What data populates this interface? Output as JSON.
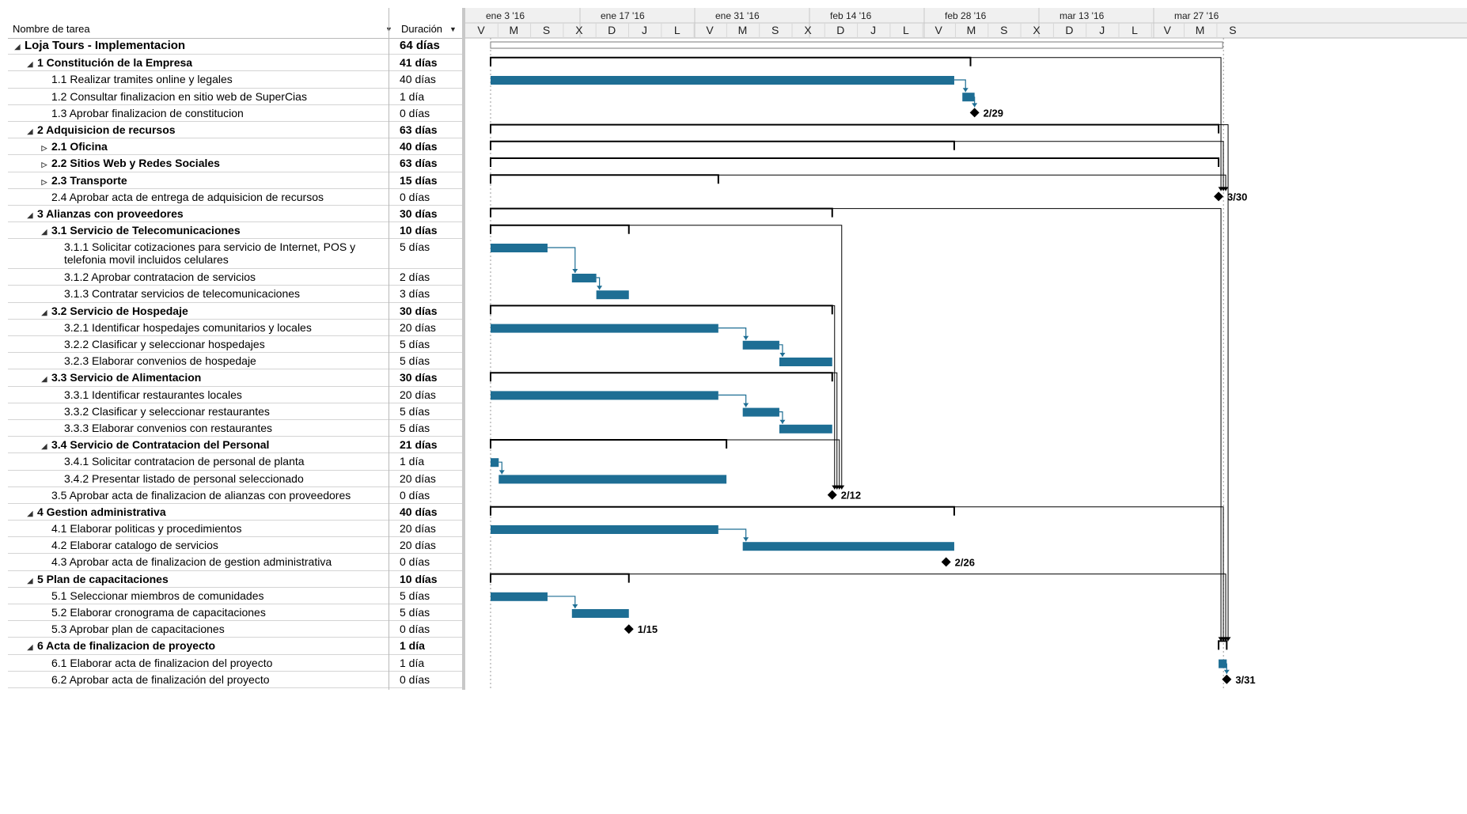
{
  "table": {
    "name_header": "Nombre de tarea",
    "duration_header": "Duración",
    "rows": [
      {
        "name": "Loja Tours - Implementacion",
        "duration": "64 días",
        "level": 0,
        "toggle": "◢",
        "bold": true,
        "big": true
      },
      {
        "name": "1 Constitución de la Empresa",
        "duration": "41 días",
        "level": 1,
        "toggle": "◢",
        "bold": true
      },
      {
        "name": "1.1 Realizar tramites online y legales",
        "duration": "40 días",
        "level": 2,
        "toggle": "",
        "bold": false
      },
      {
        "name": "1.2 Consultar finalizacion en sitio web de SuperCias",
        "duration": "1 día",
        "level": 2,
        "toggle": "",
        "bold": false
      },
      {
        "name": "1.3 Aprobar finalizacion de constitucion",
        "duration": "0 días",
        "level": 2,
        "toggle": "",
        "bold": false
      },
      {
        "name": "2 Adquisicion de recursos",
        "duration": "63 días",
        "level": 1,
        "toggle": "◢",
        "bold": true
      },
      {
        "name": "2.1 Oficina",
        "duration": "40 días",
        "level": 2,
        "toggle": "▷",
        "bold": true
      },
      {
        "name": "2.2 Sitios Web y Redes Sociales",
        "duration": "63 días",
        "level": 2,
        "toggle": "▷",
        "bold": true
      },
      {
        "name": "2.3 Transporte",
        "duration": "15 días",
        "level": 2,
        "toggle": "▷",
        "bold": true
      },
      {
        "name": "2.4 Aprobar acta de entrega de adquisicion de recursos",
        "duration": "0 días",
        "level": 2,
        "toggle": "",
        "bold": false
      },
      {
        "name": "3 Alianzas con proveedores",
        "duration": "30 días",
        "level": 1,
        "toggle": "◢",
        "bold": true
      },
      {
        "name": "3.1 Servicio de Telecomunicaciones",
        "duration": "10 días",
        "level": 2,
        "toggle": "◢",
        "bold": true
      },
      {
        "name": "3.1.1 Solicitar cotizaciones para servicio de Internet, POS y telefonia movil incluidos celulares",
        "duration": "5 días",
        "level": 3,
        "toggle": "",
        "bold": false,
        "tall": true
      },
      {
        "name": "3.1.2 Aprobar contratacion de servicios",
        "duration": "2 días",
        "level": 3,
        "toggle": "",
        "bold": false
      },
      {
        "name": "3.1.3 Contratar servicios de telecomunicaciones",
        "duration": "3 días",
        "level": 3,
        "toggle": "",
        "bold": false
      },
      {
        "name": "3.2 Servicio de Hospedaje",
        "duration": "30 días",
        "level": 2,
        "toggle": "◢",
        "bold": true
      },
      {
        "name": "3.2.1 Identificar hospedajes comunitarios y locales",
        "duration": "20 días",
        "level": 3,
        "toggle": "",
        "bold": false
      },
      {
        "name": "3.2.2 Clasificar y seleccionar hospedajes",
        "duration": "5 días",
        "level": 3,
        "toggle": "",
        "bold": false
      },
      {
        "name": "3.2.3 Elaborar convenios de hospedaje",
        "duration": "5 días",
        "level": 3,
        "toggle": "",
        "bold": false
      },
      {
        "name": "3.3 Servicio de Alimentacion",
        "duration": "30 días",
        "level": 2,
        "toggle": "◢",
        "bold": true
      },
      {
        "name": "3.3.1 Identificar restaurantes locales",
        "duration": "20 días",
        "level": 3,
        "toggle": "",
        "bold": false
      },
      {
        "name": "3.3.2 Clasificar y seleccionar restaurantes",
        "duration": "5 días",
        "level": 3,
        "toggle": "",
        "bold": false
      },
      {
        "name": "3.3.3 Elaborar convenios con restaurantes",
        "duration": "5 días",
        "level": 3,
        "toggle": "",
        "bold": false
      },
      {
        "name": "3.4 Servicio de Contratacion del Personal",
        "duration": "21 días",
        "level": 2,
        "toggle": "◢",
        "bold": true
      },
      {
        "name": "3.4.1 Solicitar contratacion de personal de planta",
        "duration": "1 día",
        "level": 3,
        "toggle": "",
        "bold": false
      },
      {
        "name": "3.4.2 Presentar listado de personal seleccionado",
        "duration": "20 días",
        "level": 3,
        "toggle": "",
        "bold": false
      },
      {
        "name": "3.5 Aprobar acta de finalizacion de alianzas con proveedores",
        "duration": "0 días",
        "level": 2,
        "toggle": "",
        "bold": false
      },
      {
        "name": "4 Gestion administrativa",
        "duration": "40 días",
        "level": 1,
        "toggle": "◢",
        "bold": true
      },
      {
        "name": "4.1 Elaborar politicas y procedimientos",
        "duration": "20 días",
        "level": 2,
        "toggle": "",
        "bold": false
      },
      {
        "name": "4.2 Elaborar catalogo de servicios",
        "duration": "20 días",
        "level": 2,
        "toggle": "",
        "bold": false
      },
      {
        "name": "4.3 Aprobar acta de finalizacion de gestion administrativa",
        "duration": "0 días",
        "level": 2,
        "toggle": "",
        "bold": false
      },
      {
        "name": "5 Plan de capacitaciones",
        "duration": "10 días",
        "level": 1,
        "toggle": "◢",
        "bold": true
      },
      {
        "name": "5.1 Seleccionar miembros de comunidades",
        "duration": "5 días",
        "level": 2,
        "toggle": "",
        "bold": false
      },
      {
        "name": "5.2 Elaborar cronograma de capacitaciones",
        "duration": "5 días",
        "level": 2,
        "toggle": "",
        "bold": false
      },
      {
        "name": "5.3 Aprobar plan de capacitaciones",
        "duration": "0 días",
        "level": 2,
        "toggle": "",
        "bold": false
      },
      {
        "name": "6 Acta de finalizacion de proyecto",
        "duration": "1 día",
        "level": 1,
        "toggle": "◢",
        "bold": true
      },
      {
        "name": "6.1 Elaborar acta de finalizacion del proyecto",
        "duration": "1 día",
        "level": 2,
        "toggle": "",
        "bold": false
      },
      {
        "name": "6.2 Aprobar acta de finalización del proyecto",
        "duration": "0 días",
        "level": 2,
        "toggle": "",
        "bold": false
      }
    ]
  },
  "chart_data": {
    "type": "gantt",
    "project_start": "2016-01-01",
    "timescale_top": [
      "ene 3 '16",
      "ene 17 '16",
      "ene 31 '16",
      "feb 14 '16",
      "feb 28 '16",
      "mar 13 '16",
      "mar 27 '16"
    ],
    "timescale_bottom": [
      "V",
      "M",
      "S",
      "X",
      "D",
      "J",
      "L",
      "V",
      "M",
      "S",
      "X",
      "D",
      "J",
      "L",
      "V",
      "M",
      "S",
      "X",
      "D",
      "J",
      "L",
      "V",
      "M",
      "S"
    ],
    "colors": {
      "task_bar": "#1e6e94",
      "summary_bar": "#000000",
      "link": "#1e6e94",
      "milestone": "#000000"
    },
    "tasks": [
      {
        "kind": "summary",
        "start": "2016-01-01",
        "end": "2016-03-31",
        "project": true
      },
      {
        "kind": "summary",
        "start": "2016-01-01",
        "end": "2016-02-29"
      },
      {
        "kind": "task",
        "start": "2016-01-01",
        "end": "2016-02-27"
      },
      {
        "kind": "task",
        "start": "2016-02-28",
        "end": "2016-02-29.5"
      },
      {
        "kind": "milestone",
        "start": "2016-02-29.5",
        "label": "2/29"
      },
      {
        "kind": "summary",
        "start": "2016-01-01",
        "end": "2016-03-30.5"
      },
      {
        "kind": "summary",
        "start": "2016-01-01",
        "end": "2016-02-27"
      },
      {
        "kind": "summary",
        "start": "2016-01-01",
        "end": "2016-03-30.5"
      },
      {
        "kind": "summary",
        "start": "2016-01-01",
        "end": "2016-01-29"
      },
      {
        "kind": "milestone",
        "start": "2016-03-30.5",
        "label": "3/30"
      },
      {
        "kind": "summary",
        "start": "2016-01-01",
        "end": "2016-02-12"
      },
      {
        "kind": "summary",
        "start": "2016-01-01",
        "end": "2016-01-18"
      },
      {
        "kind": "task",
        "start": "2016-01-01",
        "end": "2016-01-08"
      },
      {
        "kind": "task",
        "start": "2016-01-11",
        "end": "2016-01-14"
      },
      {
        "kind": "task",
        "start": "2016-01-14",
        "end": "2016-01-18"
      },
      {
        "kind": "summary",
        "start": "2016-01-01",
        "end": "2016-02-12"
      },
      {
        "kind": "task",
        "start": "2016-01-01",
        "end": "2016-01-29"
      },
      {
        "kind": "task",
        "start": "2016-02-01",
        "end": "2016-02-05.5"
      },
      {
        "kind": "task",
        "start": "2016-02-05.5",
        "end": "2016-02-12"
      },
      {
        "kind": "summary",
        "start": "2016-01-01",
        "end": "2016-02-12"
      },
      {
        "kind": "task",
        "start": "2016-01-01",
        "end": "2016-01-29"
      },
      {
        "kind": "task",
        "start": "2016-02-01",
        "end": "2016-02-05.5"
      },
      {
        "kind": "task",
        "start": "2016-02-05.5",
        "end": "2016-02-12"
      },
      {
        "kind": "summary",
        "start": "2016-01-01",
        "end": "2016-01-30"
      },
      {
        "kind": "task",
        "start": "2016-01-01",
        "end": "2016-01-02"
      },
      {
        "kind": "task",
        "start": "2016-01-02",
        "end": "2016-01-30"
      },
      {
        "kind": "milestone",
        "start": "2016-02-12",
        "label": "2/12"
      },
      {
        "kind": "summary",
        "start": "2016-01-01",
        "end": "2016-02-27"
      },
      {
        "kind": "task",
        "start": "2016-01-01",
        "end": "2016-01-29"
      },
      {
        "kind": "task",
        "start": "2016-02-01",
        "end": "2016-02-27"
      },
      {
        "kind": "milestone",
        "start": "2016-02-26",
        "label": "2/26"
      },
      {
        "kind": "summary",
        "start": "2016-01-01",
        "end": "2016-01-18"
      },
      {
        "kind": "task",
        "start": "2016-01-01",
        "end": "2016-01-08"
      },
      {
        "kind": "task",
        "start": "2016-01-11",
        "end": "2016-01-18"
      },
      {
        "kind": "milestone",
        "start": "2016-01-18",
        "label": "1/15"
      },
      {
        "kind": "summary",
        "start": "2016-03-30.5",
        "end": "2016-03-31.5"
      },
      {
        "kind": "task",
        "start": "2016-03-30.5",
        "end": "2016-03-31.5"
      },
      {
        "kind": "milestone",
        "start": "2016-03-31.5",
        "label": "3/31"
      }
    ],
    "links": [
      {
        "from": 2,
        "to": 3
      },
      {
        "from": 3,
        "to": 4
      },
      {
        "from": 12,
        "to": 13
      },
      {
        "from": 13,
        "to": 14
      },
      {
        "from": 16,
        "to": 17
      },
      {
        "from": 17,
        "to": 18
      },
      {
        "from": 20,
        "to": 21
      },
      {
        "from": 21,
        "to": 22
      },
      {
        "from": 24,
        "to": 25
      },
      {
        "from": 28,
        "to": 29
      },
      {
        "from": 32,
        "to": 33
      },
      {
        "from": 36,
        "to": 37
      }
    ]
  }
}
